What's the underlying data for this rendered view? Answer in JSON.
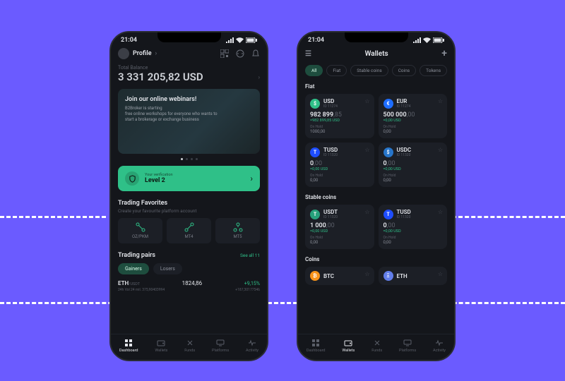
{
  "status": {
    "time": "21:04"
  },
  "phone1": {
    "profile_label": "Profile",
    "balance_label": "Total Balance",
    "balance_value": "3 331 205,82 USD",
    "banner": {
      "title": "Join our online webinars!",
      "line1": "B2Broker is starting",
      "line2": "free online workshops for everyone who wants to",
      "line3": "start a brokerage or exchange business"
    },
    "verification": {
      "label": "Your verification",
      "level": "Level 2"
    },
    "favorites": {
      "title": "Trading Favorites",
      "sub": "Create your favourite platform account",
      "items": [
        "OZ/PKM",
        "MT4",
        "MT5"
      ]
    },
    "pairs": {
      "title": "Trading pairs",
      "see_all": "See all 11",
      "tabs": [
        "Gainers",
        "Losers"
      ],
      "row": {
        "base": "ETH",
        "quote": "/USDT",
        "price": "1824,86",
        "change": "+9,15%",
        "vol_label": "24h Vol 24 mil. 375,90403994",
        "vol_right": "+187,30177546"
      }
    },
    "nav": [
      "Dashboard",
      "Wallets",
      "Funds",
      "Platforms",
      "Activity"
    ]
  },
  "phone2": {
    "title": "Wallets",
    "filters": [
      "All",
      "Fiat",
      "Stable coins",
      "Coins",
      "Tokens"
    ],
    "groups": {
      "fiat": {
        "label": "Fiat",
        "cards": [
          {
            "sym": "USD",
            "id": "ID 11274",
            "bal_int": "982 899",
            "bal_dec": ",85",
            "usd": "=982 899,85 USD",
            "hold": "1000,00",
            "badge_color": "#2fc088",
            "badge_glyph": "$"
          },
          {
            "sym": "EUR",
            "id": "ID 11274",
            "bal_int": "500 000",
            "bal_dec": ",00",
            "usd": "=0,00 USD",
            "hold": "0,00",
            "badge_color": "#1e6dff",
            "badge_glyph": "€"
          },
          {
            "sym": "TUSD",
            "id": "ID 11320",
            "bal_int": "0",
            "bal_dec": ",00",
            "usd": "=0,00 USD",
            "hold": "0,00",
            "badge_color": "#1e4dff",
            "badge_glyph": "T"
          },
          {
            "sym": "USDC",
            "id": "ID 11320",
            "bal_int": "0",
            "bal_dec": ",00",
            "usd": "=0,00 USD",
            "hold": "0,00",
            "badge_color": "#2775ca",
            "badge_glyph": "$"
          }
        ]
      },
      "stable": {
        "label": "Stable coins",
        "cards": [
          {
            "sym": "USDT",
            "id": "ID 11320",
            "bal_int": "1 000",
            "bal_dec": ",00",
            "usd": "=0,00 USD",
            "hold": "0,00",
            "badge_color": "#26a17b",
            "badge_glyph": "T"
          },
          {
            "sym": "TUSD",
            "id": "ID 11320",
            "bal_int": "0",
            "bal_dec": ",00",
            "usd": "=0,00 USD",
            "hold": "0,00",
            "badge_color": "#1e4dff",
            "badge_glyph": "T"
          }
        ]
      },
      "coins": {
        "label": "Coins",
        "cards": [
          {
            "sym": "BTC",
            "badge_color": "#f7931a",
            "badge_glyph": "₿"
          },
          {
            "sym": "ETH",
            "badge_color": "#627eea",
            "badge_glyph": "Ξ"
          }
        ]
      }
    },
    "on_hold_label": "On Hold",
    "nav": [
      "Dashboard",
      "Wallets",
      "Funds",
      "Platforms",
      "Activity"
    ]
  }
}
